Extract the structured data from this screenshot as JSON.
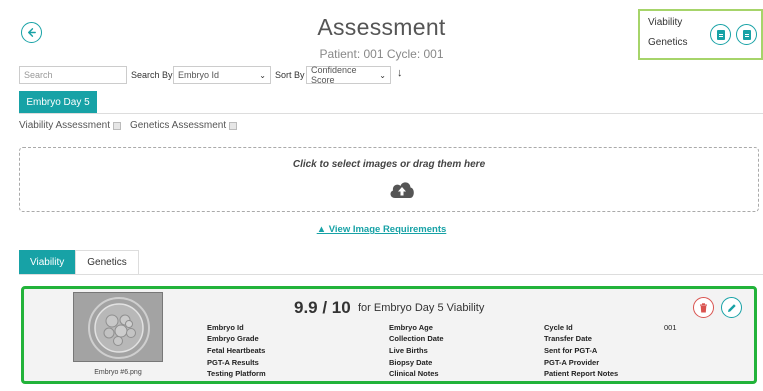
{
  "header": {
    "title": "Assessment",
    "subtitle": "Patient: 001 Cycle: 001"
  },
  "side_panel": {
    "labels": [
      "Viability",
      "Genetics"
    ]
  },
  "toolbar": {
    "search_placeholder": "Search",
    "search_by_label": "Search By",
    "search_by_value": "Embryo Id",
    "sort_by_label": "Sort By",
    "sort_by_value": "Confidence Score"
  },
  "day_button": "Embryo Day 5",
  "assessments": {
    "viability_label": "Viability Assessment",
    "genetics_label": "Genetics Assessment"
  },
  "dropzone": {
    "text": "Click to select images or drag them here"
  },
  "requirements_link": "▲ View Image Requirements",
  "tabs": [
    {
      "label": "Viability",
      "active": true
    },
    {
      "label": "Genetics",
      "active": false
    }
  ],
  "card": {
    "score": "9.9 / 10",
    "score_suffix": "for Embryo Day 5 Viability",
    "image_label": "Embryo #6.png",
    "col1": [
      "Embryo Id",
      "Embryo Grade",
      "Fetal Heartbeats",
      "PGT-A Results",
      "Testing Platform"
    ],
    "col2": [
      "Embryo Age",
      "Collection Date",
      "Live Births",
      "Biopsy Date",
      "Clinical Notes"
    ],
    "col3": [
      "Cycle Id",
      "Transfer Date",
      "Sent for PGT-A",
      "PGT-A Provider",
      "Patient Report Notes"
    ],
    "cycle_id_value": "001"
  },
  "colors": {
    "accent": "#17a2a6",
    "card_border": "#22b33a",
    "panel_border": "#a6d46a",
    "delete": "#d9534f"
  },
  "icons": [
    "back-arrow-icon",
    "report-icon",
    "cloud-upload-icon",
    "trash-icon",
    "pencil-icon",
    "chevron-down-icon",
    "arrow-down-icon"
  ]
}
